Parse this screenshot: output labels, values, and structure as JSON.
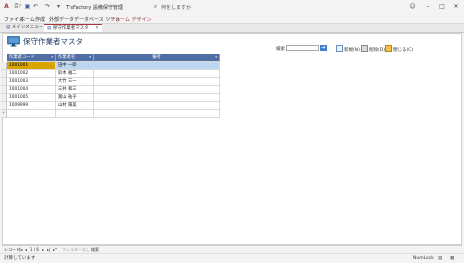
{
  "window": {
    "title": "T'sFactory 設備保守管理",
    "search_placeholder": "何をしますか"
  },
  "ribbon": {
    "tabs": [
      "ファイル",
      "ホーム",
      "作成",
      "外部データ",
      "データベース ツール",
      "フォーム デザイン"
    ]
  },
  "doc_tabs": [
    {
      "label": "メインメニュー",
      "active": false
    },
    {
      "label": "保守作業者マスタ",
      "active": true
    }
  ],
  "form": {
    "title": "保守作業者マスタ",
    "search_label": "検索",
    "search_value": "",
    "buttons": {
      "new": "新規(N)",
      "delete": "削除(D)",
      "close": "閉じる(C)"
    }
  },
  "grid": {
    "columns": [
      "作業者コード",
      "作業者名",
      "備考"
    ],
    "rows": [
      {
        "code": "1001001",
        "name": "田中 一郎",
        "note": "",
        "selected": true
      },
      {
        "code": "1001002",
        "name": "鈴木 雅二",
        "note": ""
      },
      {
        "code": "1001003",
        "name": "大竹 三一",
        "note": ""
      },
      {
        "code": "1001004",
        "name": "三井 和三",
        "note": ""
      },
      {
        "code": "1001005",
        "name": "富山 祐子",
        "note": ""
      },
      {
        "code": "1009999",
        "name": "山村 陽美",
        "note": ""
      }
    ],
    "new_row_marker": "*"
  },
  "navbar": {
    "record_label": "レコード:",
    "position": "1 / 6",
    "filter_label": "フィルターなし",
    "search_label": "検索"
  },
  "statusbar": {
    "left": "計算しています",
    "right": "NumLock"
  },
  "colors": {
    "accent": "#a4373a",
    "header": "#4f6ea3",
    "selection": "#bdd7f0",
    "selected_code": "#d9a400"
  }
}
